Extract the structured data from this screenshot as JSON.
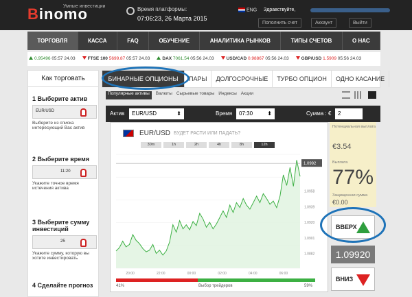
{
  "header": {
    "logo": "Binomo",
    "logo_sub": "Умные инвестиции",
    "platform_time_label": "Время платформы:",
    "platform_time": "07:06:23, 26 Марта 2015",
    "lang": "ENG",
    "greeting": "Здравствуйте,",
    "buttons": [
      "Пополнить счет",
      "Аккаунт",
      "Выйти"
    ]
  },
  "nav": {
    "items": [
      "ТОРГОВЛЯ",
      "КАССА",
      "FAQ",
      "ОБУЧЕНИЕ",
      "АНАЛИТИКА РЫНКОВ",
      "ТИПЫ СЧЕТОВ",
      "О НАС"
    ],
    "active": 0
  },
  "ticker": [
    {
      "val": "0.95496",
      "time": "05:57 24.03",
      "dir": "up",
      "name": ""
    },
    {
      "name": "FTSE 100",
      "val": "5699.87",
      "time": "05:57 24.03",
      "dir": "dn"
    },
    {
      "name": "DAX",
      "val": "7061.54",
      "time": "05:56 24.03",
      "dir": "up"
    },
    {
      "name": "USD/CAD",
      "val": "0.98867",
      "time": "05:56 24.03",
      "dir": "dn"
    },
    {
      "name": "GBP/USD",
      "val": "1.5909",
      "time": "05:56 24.03",
      "dir": "dn"
    }
  ],
  "howto": {
    "title": "Как торговать",
    "steps": [
      {
        "title": "1 Выберите актив",
        "text": "Выберите из списка интересующий Вас актив",
        "img": "EUR/USD"
      },
      {
        "title": "2 Выберите время",
        "text": "Укажите точное время истечения актива",
        "img": "11:20"
      },
      {
        "title": "3 Выберите сумму инвестиций",
        "text": "Укажите сумму, которую вы хотите инвестировать",
        "img": "25"
      },
      {
        "title": "4 Сделайте прогноз",
        "text": "",
        "img": ""
      }
    ]
  },
  "tabs": {
    "items": [
      "БИНАРНЫЕ ОПЦИОНЫ",
      "ПАРЫ",
      "ДОЛГОСРОЧНЫЕ",
      "ТУРБО ОПЦИОН",
      "ОДНО КАСАНИЕ"
    ],
    "active": 0
  },
  "subtabs": {
    "items": [
      "Популярные активы",
      "Валюты",
      "Сырьевые товары",
      "Индексы",
      "Акции"
    ],
    "active": 0
  },
  "controls": {
    "asset_label": "Актив",
    "asset": "EUR/USD",
    "time_label": "Время",
    "time": "07:30",
    "amount_label": "Сумма :",
    "currency": "€",
    "amount": "2"
  },
  "chart_panel": {
    "pair": "EUR/USD",
    "question": "БУДЕТ РАСТИ ИЛИ ПАДАТЬ?",
    "ranges": [
      "30m",
      "1h",
      "2h",
      "4h",
      "8h",
      "12h"
    ],
    "active_range": 5,
    "current_price": "1.0992",
    "vote_left": "41%",
    "vote_right": "59%",
    "vote_label": "Выбор трейдеров"
  },
  "chart_data": {
    "type": "area",
    "x": [
      "20:00",
      "22:00",
      "00:00",
      "02:00",
      "04:00",
      "06:00"
    ],
    "ylim": [
      1.0864,
      1.1003
    ],
    "yticks": [
      "1.0992",
      "1.0958",
      "1.0939",
      "1.0920",
      "1.0901",
      "1.0882"
    ],
    "values": [
      1.0885,
      1.0889,
      1.0897,
      1.089,
      1.0893,
      1.0905,
      1.0898,
      1.0894,
      1.0888,
      1.0884,
      1.0886,
      1.0893,
      1.0882,
      1.0886,
      1.088,
      1.0885,
      1.0896,
      1.0917,
      1.0908,
      1.0922,
      1.0912,
      1.0917,
      1.0911,
      1.0921,
      1.0916,
      1.0931,
      1.0924,
      1.0914,
      1.092,
      1.0912,
      1.0918,
      1.0926,
      1.0934,
      1.0926,
      1.0941,
      1.0932,
      1.0944,
      1.0938,
      1.0949,
      1.0941,
      1.0936,
      1.0944,
      1.0952,
      1.0944,
      1.0955,
      1.0949,
      1.0942,
      1.0946,
      1.0938,
      1.0952,
      1.0978,
      1.0965,
      1.0987,
      1.0964,
      1.0996,
      1.0976
    ],
    "vote_up_pct": 59,
    "colors": {
      "line": "#3cb043",
      "fill": "#dff2df"
    }
  },
  "side": {
    "payout_label": "Потенциальная выплата",
    "payout": "€3.54",
    "percent_label": "Выплата",
    "percent": "77%",
    "protected_label": "Защищенная сумма",
    "protected": "€0.00",
    "up": "ВВЕРХ",
    "down": "ВНИЗ",
    "price": "1.09920"
  }
}
